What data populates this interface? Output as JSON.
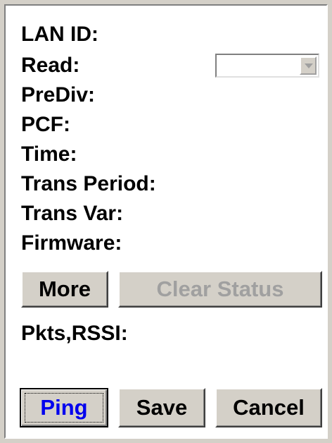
{
  "fields": {
    "lan_id": "LAN ID:",
    "read": "Read:",
    "prediv": "PreDiv:",
    "pcf": "PCF:",
    "time": "Time:",
    "trans_period": "Trans Period:",
    "trans_var": "Trans Var:",
    "firmware": "Firmware:",
    "pkts_rssi": "Pkts,RSSI:"
  },
  "read_select": {
    "value": ""
  },
  "buttons": {
    "more": "More",
    "clear_status": "Clear Status",
    "ping": "Ping",
    "save": "Save",
    "cancel": "Cancel"
  },
  "colors": {
    "window_bg": "#d4d0c8",
    "panel_bg": "#ffffff",
    "ping_text": "#0000ee",
    "disabled_text": "#a0a0a0"
  }
}
